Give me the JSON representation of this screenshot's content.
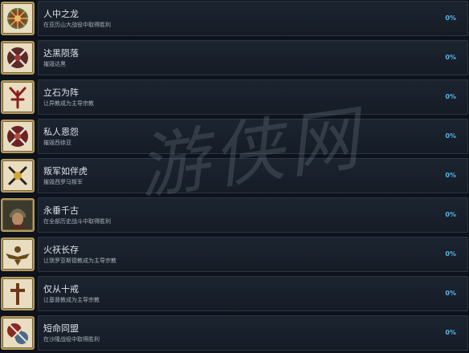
{
  "achievements": [
    {
      "title": "人中之龙",
      "desc": "在亚历山大战役中取得胜利",
      "percent": "0%",
      "icon": "crest-medallion-icon"
    },
    {
      "title": "达黑陨落",
      "desc": "摧毁达黑",
      "percent": "0%",
      "icon": "crossed-swords-shield-icon"
    },
    {
      "title": "立石为阵",
      "desc": "让异教成为主导宗教",
      "percent": "0%",
      "icon": "pagan-symbol-icon"
    },
    {
      "title": "私人恩怨",
      "desc": "摧毁西徐亚",
      "percent": "0%",
      "icon": "crossed-swords-shield-icon"
    },
    {
      "title": "叛军如伴虎",
      "desc": "摧毁西罗马叛军",
      "percent": "0%",
      "icon": "crossed-swords-gold-icon"
    },
    {
      "title": "永垂千古",
      "desc": "在全部历史战斗中取得胜利",
      "percent": "0%",
      "icon": "helmet-warrior-portrait-icon"
    },
    {
      "title": "火祆长存",
      "desc": "让琐罗亚斯德教成为主导宗教",
      "percent": "0%",
      "icon": "faravahar-icon"
    },
    {
      "title": "仅从十戒",
      "desc": "让基督教成为主导宗教",
      "percent": "0%",
      "icon": "cross-icon"
    },
    {
      "title": "短命同盟",
      "desc": "在沙隆战役中取得胜利",
      "percent": "0%",
      "icon": "broken-alliance-icon"
    }
  ],
  "watermark": "游侠网"
}
